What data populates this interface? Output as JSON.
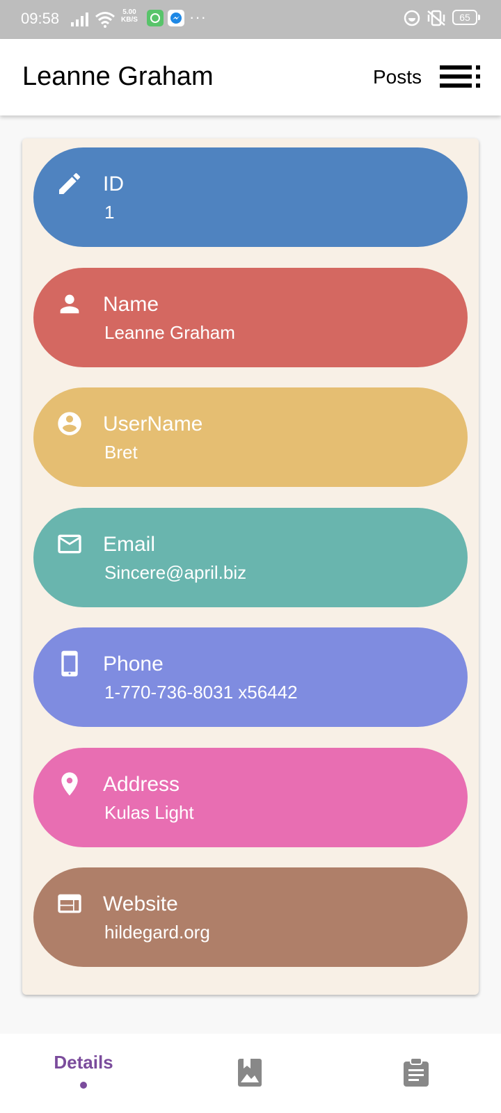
{
  "status_bar": {
    "time": "09:58",
    "net_speed_value": "5.00",
    "net_speed_unit": "KB/S",
    "more": "···",
    "battery": "65"
  },
  "app_bar": {
    "title": "Leanne Graham",
    "posts_link": "Posts"
  },
  "fields": [
    {
      "icon": "pencil-icon",
      "label": "ID",
      "value": "1",
      "color": "#4f83c0"
    },
    {
      "icon": "person-icon",
      "label": "Name",
      "value": "Leanne Graham",
      "color": "#d46861"
    },
    {
      "icon": "account-circle-icon",
      "label": "UserName",
      "value": "Bret",
      "color": "#e5be72"
    },
    {
      "icon": "mail-icon",
      "label": "Email",
      "value": "Sincere@april.biz",
      "color": "#69b5ae"
    },
    {
      "icon": "smartphone-icon",
      "label": "Phone",
      "value": "1-770-736-8031 x56442",
      "color": "#7f8ce0"
    },
    {
      "icon": "location-pin-icon",
      "label": "Address",
      "value": "Kulas Light",
      "color": "#e86eb2"
    },
    {
      "icon": "web-icon",
      "label": "Website",
      "value": "hildegard.org",
      "color": "#af7f69"
    }
  ],
  "bottom_nav": {
    "details_label": "Details",
    "active_color": "#7b4c9c",
    "inactive_color": "#888888",
    "items": [
      "details-tab",
      "photos-icon",
      "posts-clipboard-icon"
    ]
  }
}
